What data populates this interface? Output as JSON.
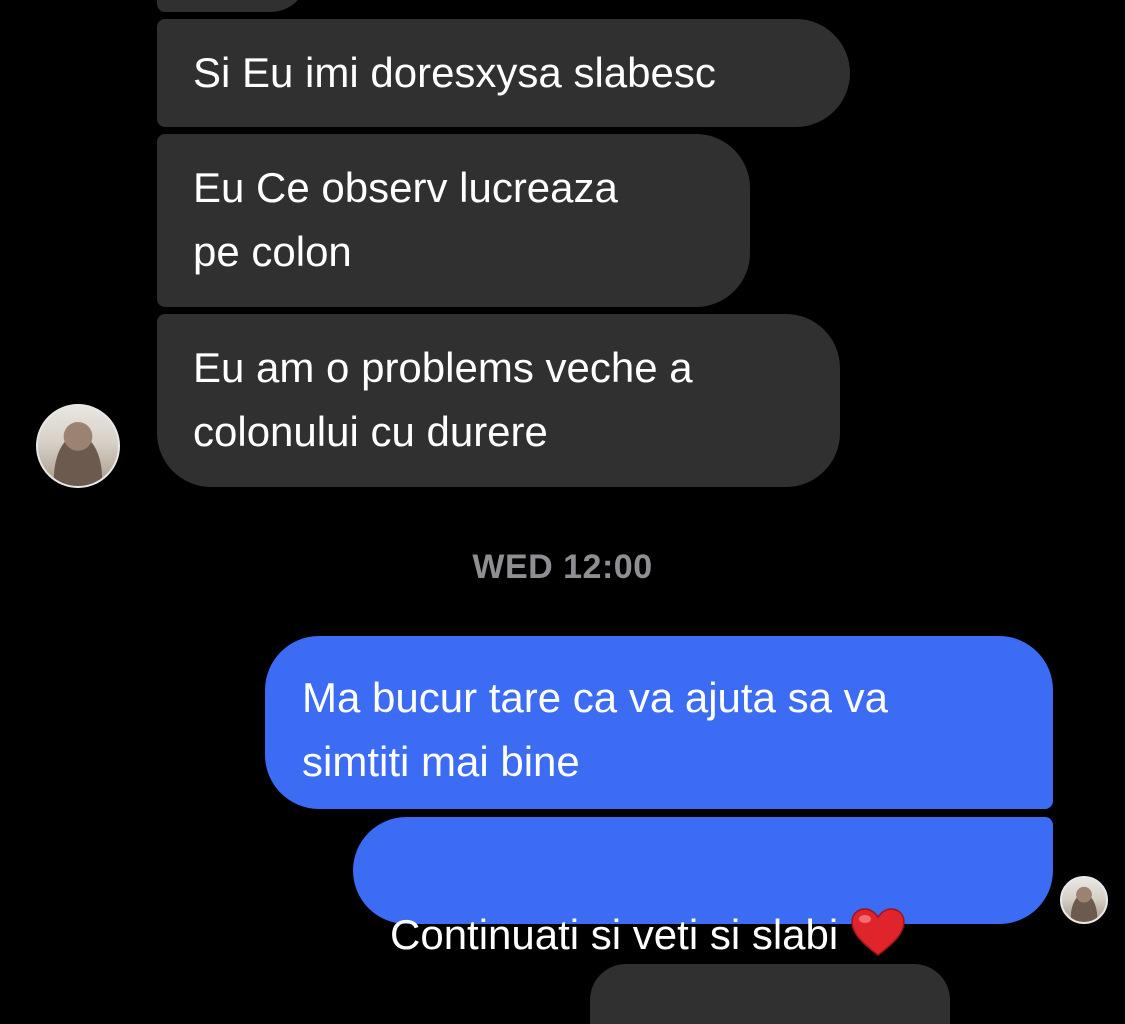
{
  "conversation": {
    "incoming": [
      {
        "text": "Si Eu imi doresxysa slabesc"
      },
      {
        "text": "Eu Ce observ lucreaza\npe colon"
      },
      {
        "text": "Eu am o problems veche a\ncolonului cu durere"
      }
    ],
    "timestamp": "WED 12:00",
    "outgoing": [
      {
        "text": "Ma bucur tare ca va ajuta sa va\nsimtiti mai bine"
      },
      {
        "text": "Continuati si veti si slabi",
        "emoji": "heart-emoji"
      }
    ]
  },
  "colors": {
    "background": "#000000",
    "incoming_bubble": "#303030",
    "outgoing_bubble": "#3b6cf3",
    "timestamp_text": "#8e8e93",
    "heart": "#e0242b"
  }
}
